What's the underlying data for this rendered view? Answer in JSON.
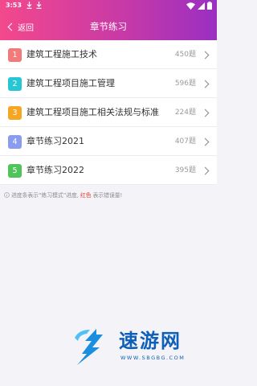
{
  "status_bar": {
    "time": "3:53"
  },
  "header": {
    "back_label": "返回",
    "title": "章节练习"
  },
  "chapters": [
    {
      "number": "1",
      "title": "建筑工程施工技术",
      "count": "450题",
      "color": "#f27a7a"
    },
    {
      "number": "2",
      "title": "建筑工程项目施工管理",
      "count": "596题",
      "color": "#26c6d4"
    },
    {
      "number": "3",
      "title": "建筑工程项目施工相关法规与标准",
      "count": "224题",
      "color": "#f5a623"
    },
    {
      "number": "4",
      "title": "章节练习2021",
      "count": "407题",
      "color": "#8a9cf0"
    },
    {
      "number": "5",
      "title": "章节练习2022",
      "count": "395题",
      "color": "#4fc45a"
    }
  ],
  "note": {
    "prefix": "进度条表示“练习模式”进度,",
    "red": "红色",
    "suffix": "表示错误量!"
  },
  "watermark": {
    "text": "速游网",
    "sub": "WWW.SBGBG.COM"
  }
}
